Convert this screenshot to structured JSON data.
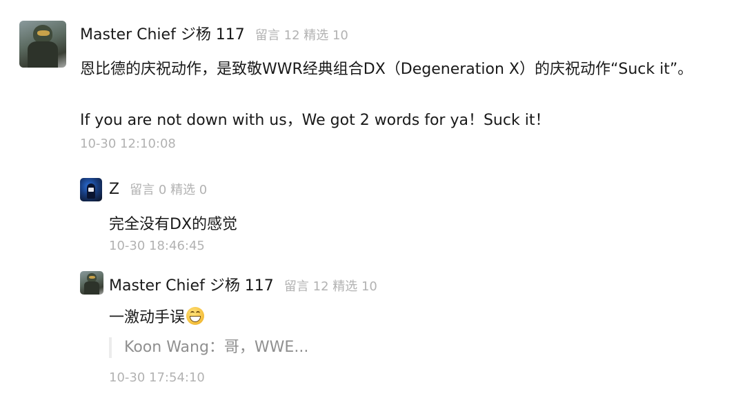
{
  "comments": [
    {
      "author": "Master Chief ジ杨 117",
      "meta": "留言 12 精选 10",
      "lines": [
        "恩比德的庆祝动作，是致敬WWR经典组合DX（Degeneration X）的庆祝动作“Suck it”。",
        "If you are not down with us，We got 2 words for ya！Suck it！"
      ],
      "time": "10-30 12:10:08"
    }
  ],
  "replies": [
    {
      "author": "Z",
      "meta": "留言 0 精选 0",
      "text": "完全没有DX的感觉",
      "time": "10-30 18:46:45"
    },
    {
      "author": "Master Chief ジ杨 117",
      "meta": "留言 12 精选 10",
      "text": "一激动手误",
      "emoji": "grinning-face-emoji",
      "quote": "Koon Wang：哥，WWE...",
      "time": "10-30 17:54:10"
    }
  ]
}
